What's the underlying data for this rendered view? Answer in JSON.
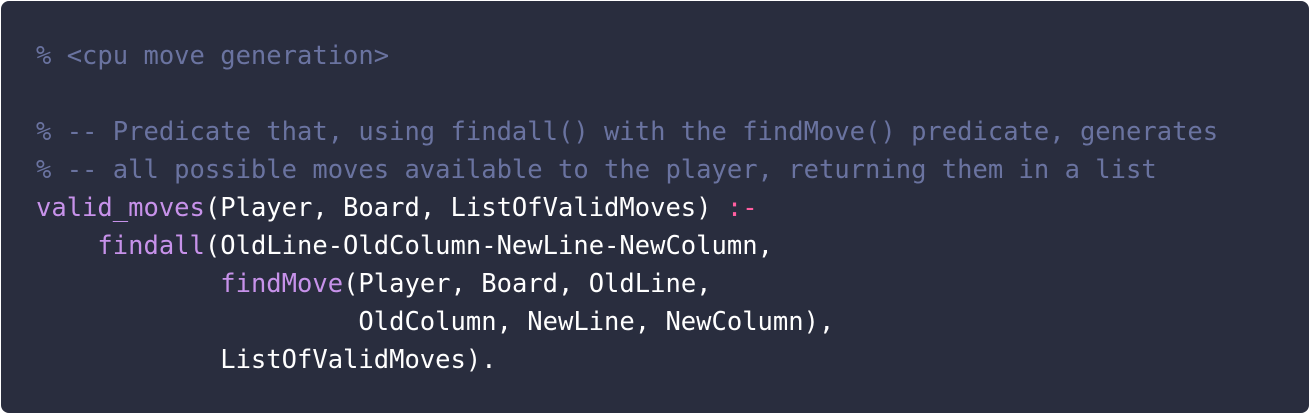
{
  "code": {
    "language": "prolog",
    "lines": [
      [
        {
          "t": "comment",
          "text": "% <cpu move generation>"
        }
      ],
      [],
      [
        {
          "t": "comment",
          "text": "% -- Predicate that, using findall() with the findMove() predicate, generates"
        }
      ],
      [
        {
          "t": "comment",
          "text": "% -- all possible moves available to the player, returning them in a list"
        }
      ],
      [
        {
          "t": "fn",
          "text": "valid_moves"
        },
        {
          "t": "plain",
          "text": "(Player, Board, ListOfValidMoves) "
        },
        {
          "t": "op",
          "text": ":-"
        }
      ],
      [
        {
          "t": "plain",
          "text": "    "
        },
        {
          "t": "fn",
          "text": "findall"
        },
        {
          "t": "plain",
          "text": "(OldLine-OldColumn-NewLine-NewColumn,"
        }
      ],
      [
        {
          "t": "plain",
          "text": "            "
        },
        {
          "t": "fn",
          "text": "findMove"
        },
        {
          "t": "plain",
          "text": "(Player, Board, OldLine,"
        }
      ],
      [
        {
          "t": "plain",
          "text": "                     OldColumn, NewLine, NewColumn),"
        }
      ],
      [
        {
          "t": "plain",
          "text": "            ListOfValidMoves)."
        }
      ]
    ]
  },
  "colors": {
    "background": "#292d3e",
    "comment": "#6a73a0",
    "function": "#c792ea",
    "operator": "#ff5ea0",
    "text": "#ffffff"
  }
}
